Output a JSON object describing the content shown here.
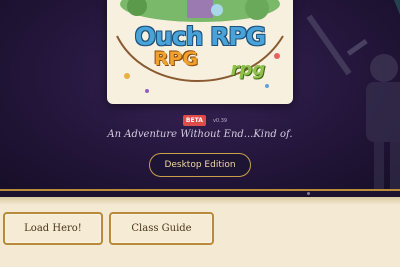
{
  "logo": {
    "line1": "Ouch RPG",
    "line2": "RPG",
    "line3": "rpg"
  },
  "version": {
    "badge": "BETA",
    "number": "v0.39"
  },
  "tagline": "An Adventure Without End...Kind of.",
  "edition_button": "Desktop Edition",
  "actions": {
    "load": "Load Hero!",
    "guide": "Class Guide"
  },
  "colors": {
    "background": "#1c1230",
    "gold": "#b88a3a",
    "parchment": "#f4ead4",
    "beta": "#e04a4a"
  }
}
